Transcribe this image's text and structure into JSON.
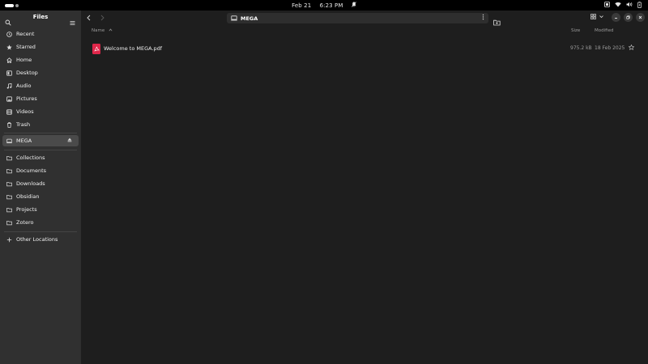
{
  "topbar": {
    "date": "Feb 21",
    "time": "6:23 PM"
  },
  "sidebar": {
    "title": "Files",
    "places": [
      {
        "label": "Recent",
        "icon": "clock-icon"
      },
      {
        "label": "Starred",
        "icon": "star-icon"
      },
      {
        "label": "Home",
        "icon": "home-icon"
      },
      {
        "label": "Desktop",
        "icon": "desktop-icon"
      },
      {
        "label": "Audio",
        "icon": "music-note-icon"
      },
      {
        "label": "Pictures",
        "icon": "image-icon"
      },
      {
        "label": "Videos",
        "icon": "film-icon"
      },
      {
        "label": "Trash",
        "icon": "trash-icon"
      }
    ],
    "device": {
      "label": "MEGA",
      "icon": "drive-icon"
    },
    "bookmarks": [
      {
        "label": "Collections",
        "icon": "folder-icon"
      },
      {
        "label": "Documents",
        "icon": "folder-icon"
      },
      {
        "label": "Downloads",
        "icon": "folder-icon"
      },
      {
        "label": "Obsidian",
        "icon": "folder-icon"
      },
      {
        "label": "Projects",
        "icon": "folder-icon"
      },
      {
        "label": "Zotero",
        "icon": "folder-icon"
      }
    ],
    "other": {
      "label": "Other Locations",
      "icon": "plus-icon"
    }
  },
  "header": {
    "path": "MEGA"
  },
  "columns": {
    "name": "Name",
    "size": "Size",
    "modified": "Modified"
  },
  "files": [
    {
      "name": "Welcome to MEGA.pdf",
      "size": "975.2 kB",
      "modified": "18 Feb 2025",
      "icon": "pdf-icon"
    }
  ],
  "colors": {
    "sidebar_bg": "#303030",
    "main_bg": "#1e1e1e",
    "active_item": "#4a4a4a",
    "pdf_accent": "#e0274a"
  }
}
